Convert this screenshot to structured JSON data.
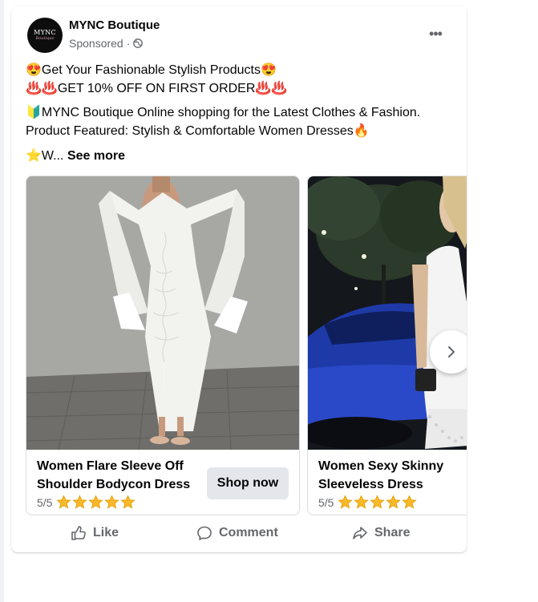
{
  "post": {
    "page_name": "MYNC Boutique",
    "avatar_logo_top": "MYNC",
    "avatar_logo_bottom": "Boutique",
    "sponsored": "Sponsored",
    "separator": "·",
    "line1": "😍Get Your Fashionable Stylish Products😍",
    "line2": "♨️♨️GET 10% OFF ON FIRST ORDER♨️♨️",
    "line3": "🔰MYNC Boutique Online shopping for the Latest Clothes & Fashion.",
    "line4": "Product Featured: Stylish & Comfortable Women Dresses🔥",
    "line5_start": "⭐W...",
    "see_more": "See more"
  },
  "cards": [
    {
      "title": "Women Flare Sleeve Off Shoulder Bodycon Dress",
      "rating_text": "5/5",
      "stars": 5,
      "cta": "Shop now",
      "image": "white-flare-sleeve-bodycon-dress-photo"
    },
    {
      "title": "Women Sexy Skinny Sleeveless Dress",
      "rating_text": "5/5",
      "stars": 5,
      "image": "white-sleeveless-dress-blue-car-photo"
    }
  ],
  "actions": {
    "like": "Like",
    "comment": "Comment",
    "share": "Share"
  },
  "colors": {
    "text_primary": "#050505",
    "text_secondary": "#65676b",
    "button_bg": "#e4e6eb",
    "star": "#f7b928",
    "border": "#dadde1"
  },
  "icons": [
    "globe-icon",
    "more-options-icon",
    "chevron-right-icon",
    "like-icon",
    "comment-icon",
    "share-icon",
    "star-icon"
  ]
}
